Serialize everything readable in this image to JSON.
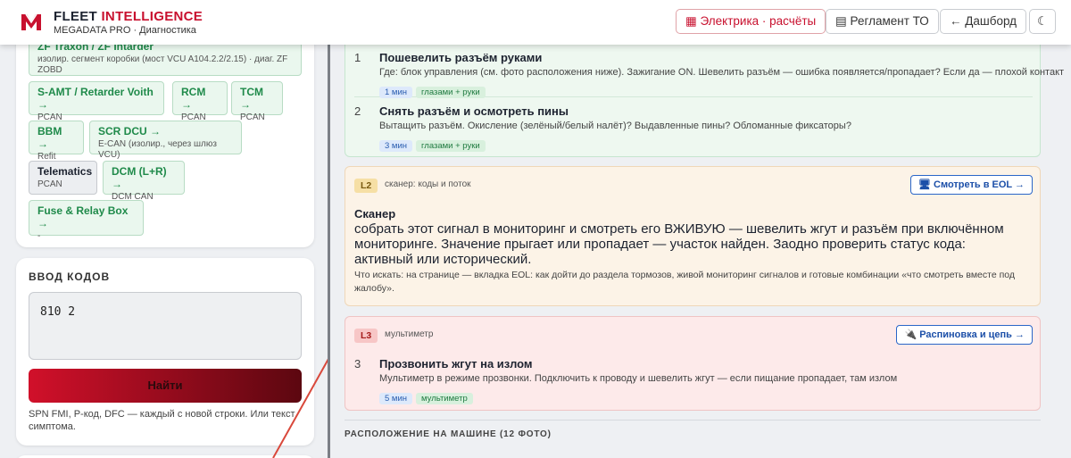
{
  "header": {
    "brand_main": "FLEET ",
    "brand_accent": "INTELLIGENCE",
    "subtitle": "MEGADATA PRO · Диагностика",
    "buttons": [
      {
        "icon": "calculator-icon",
        "glyph": "▦",
        "label": "Электрика · расчёты"
      },
      {
        "icon": "document-icon",
        "glyph": "▤",
        "label": "Регламент ТО"
      },
      {
        "icon": "arrow-left-icon",
        "glyph": "←",
        "label": "Дашборд"
      },
      {
        "icon": "moon-icon",
        "glyph": "☾",
        "label": ""
      }
    ],
    "accent_color": "#c8102e"
  },
  "modules": {
    "cut_chip": {
      "title": "ZF Traxon / ZF Intarder",
      "subtitle": "изолир. сегмент коробки (мост VCU A104.2.2/2.15) · диаг. ZF ZOBD"
    },
    "items": [
      {
        "title": "S-AMT / Retarder Voith →",
        "subtitle": "PCAN"
      },
      {
        "title": "RCM →",
        "subtitle": "PCAN"
      },
      {
        "title": "TCM →",
        "subtitle": "PCAN"
      },
      {
        "title": "BBM →",
        "subtitle": "Refit CAN"
      },
      {
        "title": "SCR DCU →",
        "subtitle": "E-CAN (изолир., через шлюз VCU)"
      },
      {
        "title": "Telematics",
        "subtitle": "PCAN"
      },
      {
        "title": "DCM (L+R) →",
        "subtitle": "DCM CAN"
      },
      {
        "title": "Fuse & Relay Box →",
        "subtitle": "-"
      }
    ]
  },
  "code_input": {
    "title": "ВВОД КОДОВ",
    "value": "810 2",
    "find_label": "Найти",
    "hint": "SPN FMI, P-код, DFC — каждый с новой строки. Или текст симптома."
  },
  "levels": {
    "l1": {
      "steps": [
        {
          "num": "1",
          "title": "Пошевелить разъём руками",
          "desc": "Где: блок управления (см. фото расположения ниже). Зажигание ON. Шевелить разъём — ошибка появляется/пропадает? Если да — плохой контакт",
          "time": "1 мин",
          "method": "глазами + руки"
        },
        {
          "num": "2",
          "title": "Снять разъём и осмотреть пины",
          "desc": "Вытащить разъём. Окисление (зелёный/белый налёт)? Выдавленные пины? Обломанные фиксаторы?",
          "time": "3 мин",
          "method": "глазами + руки"
        }
      ]
    },
    "l2": {
      "badge": "L2",
      "label": "сканер: коды и поток",
      "button": "🖥 Смотреть в EOL →",
      "heading": "Сканер",
      "body": "собрать этот сигнал в мониторинг и смотреть его ВЖИВУЮ — шевелить жгут и разъём при включённом мониторинге. Значение прыгает или пропадает — участок найден. Заодно проверить статус кода: активный или исторический.",
      "note": "Что искать: на странице — вкладка EOL: как дойти до раздела тормозов, живой мониторинг сигналов и готовые комбинации «что смотреть вместе под жалобу»."
    },
    "l3": {
      "badge": "L3",
      "label": "мультиметр",
      "button": "🔌 Распиновка и цепь →",
      "step": {
        "num": "3",
        "title": "Прозвонить жгут на излом",
        "desc": "Мультиметр в режиме прозвонки. Подключить к проводу и шевелить жгут — если пищание пропадает, там излом",
        "time": "5 мин",
        "method": "мультиметр"
      }
    }
  },
  "location": {
    "title": "РАСПОЛОЖЕНИЕ НА МАШИНЕ (12 ФОТО)"
  }
}
